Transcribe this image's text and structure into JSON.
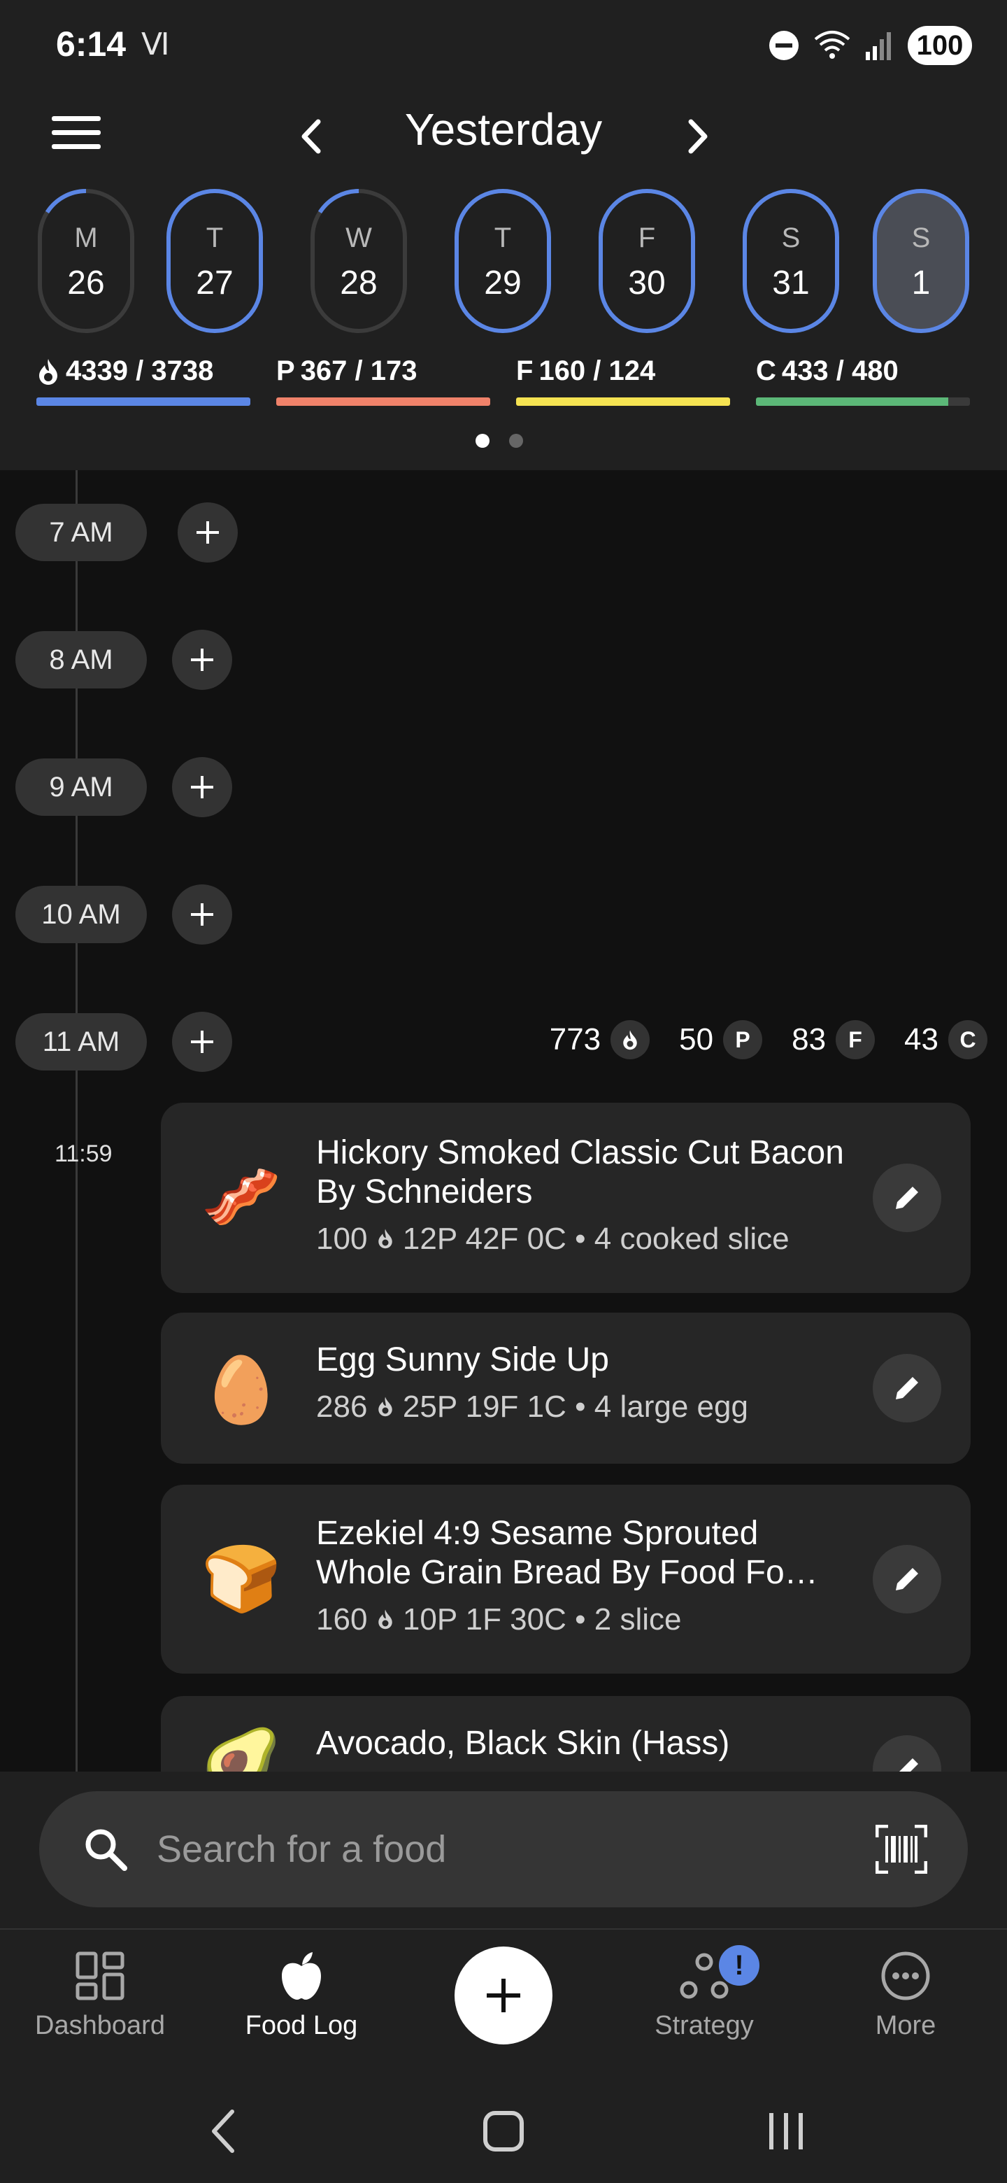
{
  "status_bar": {
    "time": "6:14",
    "carrier_icon": "Ⅵ",
    "battery": "100"
  },
  "header": {
    "title": "Yesterday",
    "days": [
      {
        "letter": "M",
        "date": "26",
        "progress": 0.12,
        "selected": false
      },
      {
        "letter": "T",
        "date": "27",
        "progress": 1.0,
        "selected": false
      },
      {
        "letter": "W",
        "date": "28",
        "progress": 0.12,
        "selected": false
      },
      {
        "letter": "T",
        "date": "29",
        "progress": 1.0,
        "selected": false
      },
      {
        "letter": "F",
        "date": "30",
        "progress": 1.0,
        "selected": false
      },
      {
        "letter": "S",
        "date": "31",
        "progress": 1.0,
        "selected": false
      },
      {
        "letter": "S",
        "date": "1",
        "progress": 1.0,
        "selected": true
      }
    ],
    "macros": {
      "energy": {
        "text": "4339 / 3738",
        "fill": 1.0,
        "color": "#5b86e5"
      },
      "protein": {
        "letter": "P",
        "text": "367 / 173",
        "fill": 1.0,
        "color": "#f0826a"
      },
      "fat": {
        "letter": "F",
        "text": "160 / 124",
        "fill": 1.0,
        "color": "#f5e352"
      },
      "carbs": {
        "letter": "C",
        "text": "433 / 480",
        "fill": 0.9,
        "color": "#5cb878"
      }
    }
  },
  "timeline": {
    "hours": [
      "7 AM",
      "8 AM",
      "9 AM",
      "10 AM",
      "11 AM"
    ],
    "totals": {
      "energy": "773",
      "protein": "50",
      "protein_letter": "P",
      "fat": "83",
      "fat_letter": "F",
      "carbs": "43",
      "carbs_letter": "C"
    },
    "meal_time": "11:59",
    "entries": [
      {
        "icon": "bacon-icon",
        "emoji": "🥓",
        "name": "Hickory Smoked Classic Cut Bacon By Schneiders",
        "energy": "100",
        "macros": "12P  42F  0C",
        "serving": "4 cooked slice"
      },
      {
        "icon": "egg-icon",
        "emoji": "🥚",
        "name": "Egg Sunny Side Up",
        "energy": "286",
        "macros": "25P  19F  1C",
        "serving": "4 large egg"
      },
      {
        "icon": "bread-icon",
        "emoji": "🍞",
        "name": "Ezekiel 4:9 Sesame Sprouted Whole Grain Bread By Food Fo…",
        "energy": "160",
        "macros": "10P  1F  30C",
        "serving": "2 slice"
      },
      {
        "icon": "avocado-icon",
        "emoji": "🥑",
        "name": "Avocado, Black Skin (Hass)"
      }
    ]
  },
  "search": {
    "placeholder": "Search for a food"
  },
  "bottom_nav": {
    "dashboard": "Dashboard",
    "food_log": "Food Log",
    "strategy": "Strategy",
    "strategy_badge": "!",
    "more": "More"
  },
  "colors": {
    "accent": "#5b86e5",
    "background": "#111111",
    "surface": "#202020",
    "card": "#262626"
  }
}
